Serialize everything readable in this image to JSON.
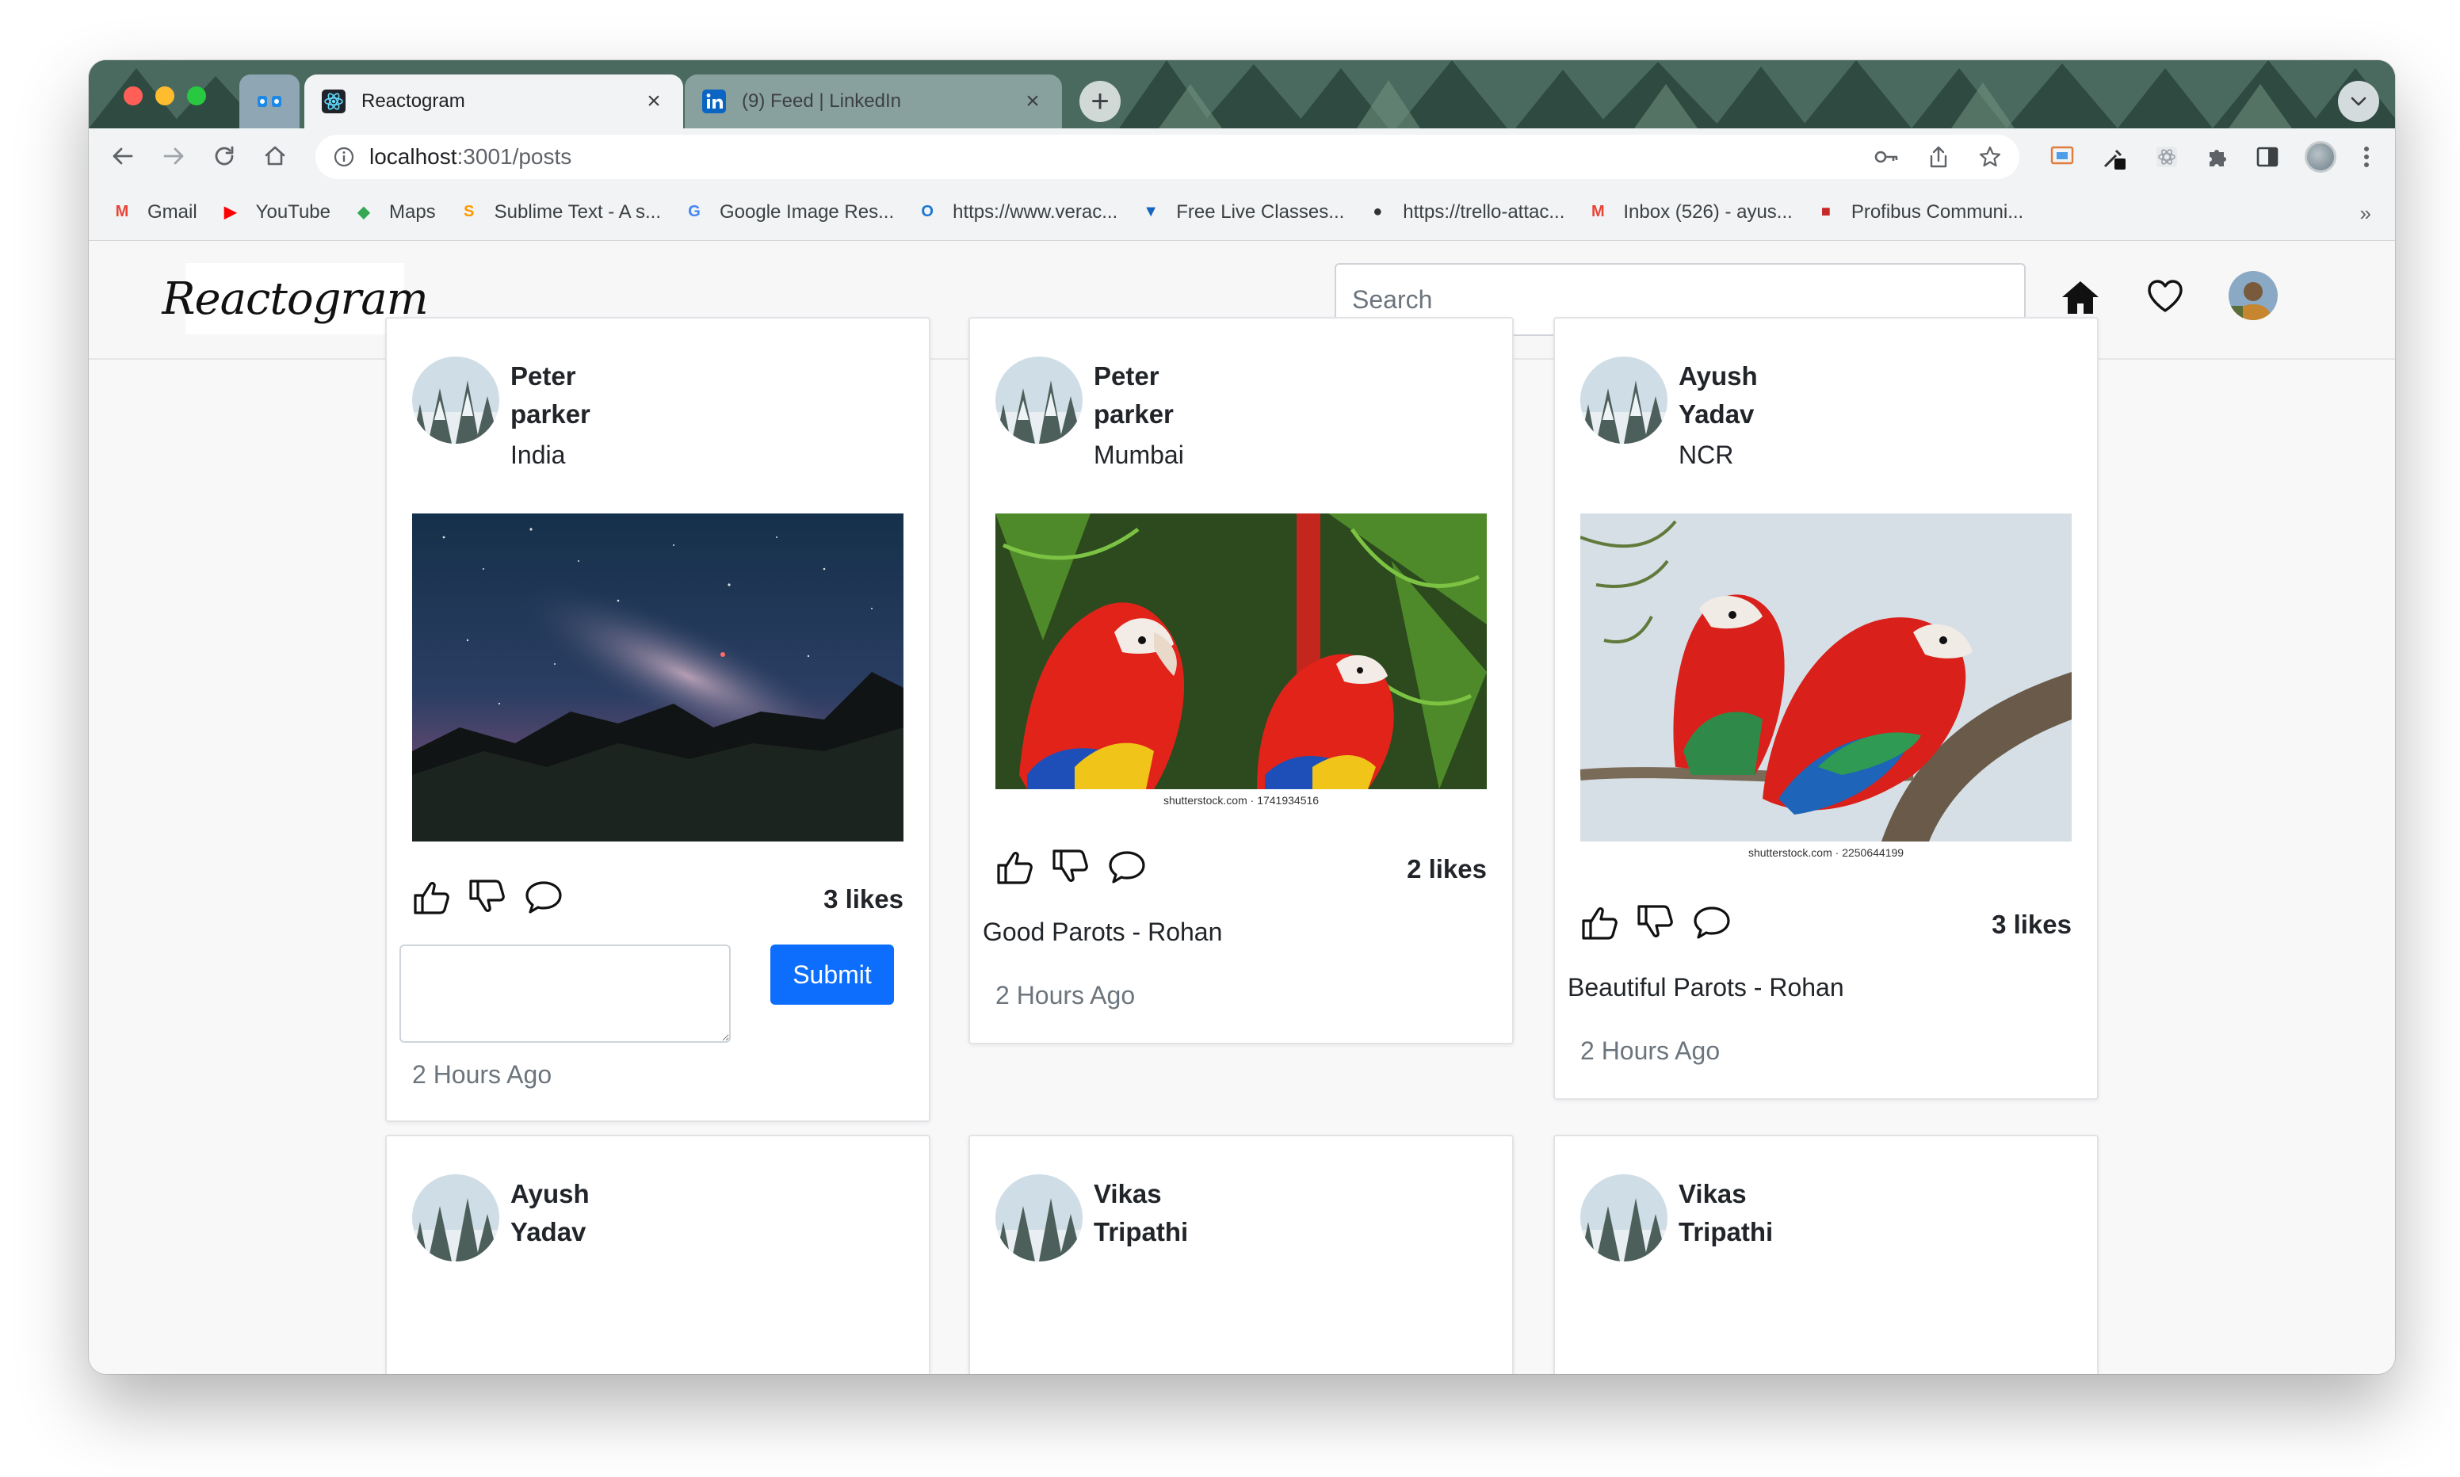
{
  "browser": {
    "tabs": [
      {
        "title": "Reactogram",
        "active": true
      },
      {
        "title": "(9) Feed | LinkedIn",
        "active": false
      }
    ],
    "url": {
      "host": "localhost",
      "path": ":3001/posts"
    },
    "bookmarks": [
      {
        "label": "Gmail",
        "icon": "gmail-icon",
        "color": "#ea4335"
      },
      {
        "label": "YouTube",
        "icon": "youtube-icon",
        "color": "#ff0000"
      },
      {
        "label": "Maps",
        "icon": "maps-icon",
        "color": "#34a853"
      },
      {
        "label": "Sublime Text - A s...",
        "icon": "sublime-icon",
        "color": "#ff9800"
      },
      {
        "label": "Google Image Res...",
        "icon": "google-icon",
        "color": "#4285f4"
      },
      {
        "label": "https://www.verac...",
        "icon": "veracode-icon",
        "color": "#1976d2"
      },
      {
        "label": "Free Live Classes...",
        "icon": "classes-icon",
        "color": "#1565c0"
      },
      {
        "label": "https://trello-attac...",
        "icon": "globe-icon",
        "color": "#333333"
      },
      {
        "label": "Inbox (526) - ayus...",
        "icon": "gmail-icon",
        "color": "#ea4335"
      },
      {
        "label": "Profibus Communi...",
        "icon": "profibus-icon",
        "color": "#c62828"
      }
    ]
  },
  "app": {
    "logo": "Reactogram",
    "search_placeholder": "Search",
    "accent": "#0d6efd"
  },
  "posts": [
    {
      "first": "Peter",
      "last": "parker",
      "location": "India",
      "likes": "3 likes",
      "caption": "",
      "time": "2 Hours Ago",
      "image": "night-sky",
      "submit": "Submit",
      "credit": ""
    },
    {
      "first": "Peter",
      "last": "parker",
      "location": "Mumbai",
      "likes": "2 likes",
      "caption": "Good Parots - Rohan",
      "time": "2 Hours Ago",
      "image": "parrots",
      "credit": "shutterstock.com · 1741934516"
    },
    {
      "first": "Ayush",
      "last": "Yadav",
      "location": "NCR",
      "likes": "3 likes",
      "caption": "Beautiful Parots - Rohan",
      "time": "2 Hours Ago",
      "image": "parrots-branch",
      "credit": "shutterstock.com · 2250644199"
    },
    {
      "first": "Ayush",
      "last": "Yadav"
    },
    {
      "first": "Vikas",
      "last": "Tripathi"
    },
    {
      "first": "Vikas",
      "last": "Tripathi"
    }
  ]
}
